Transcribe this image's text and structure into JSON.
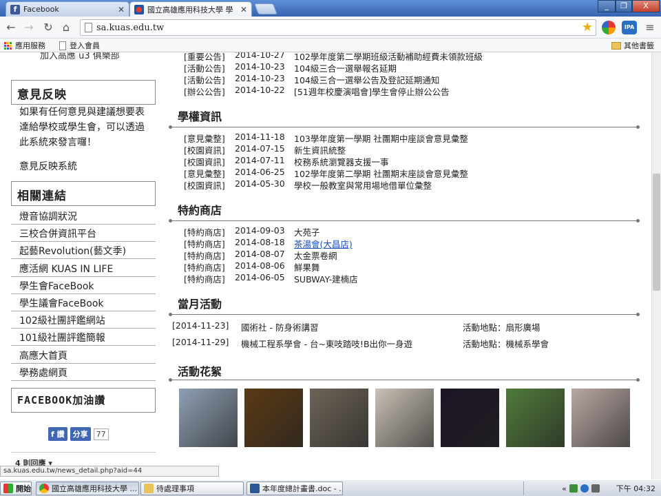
{
  "browser": {
    "tabs": [
      {
        "label": "Facebook",
        "icon": "facebook-icon"
      },
      {
        "label": "國立高雄應用科技大學 學",
        "icon": "kuas-favicon-icon"
      }
    ],
    "window_buttons": [
      "_",
      "❐",
      "X"
    ],
    "url": "sa.kuas.edu.tw",
    "bookmarks": [
      {
        "label": "應用服務",
        "icon": "apps-grid-icon"
      },
      {
        "label": "登入會員",
        "icon": "page-icon"
      }
    ],
    "other_bookmarks": "其他書籤",
    "status_url": "sa.kuas.edu.tw/news_detail.php?aid=44"
  },
  "sidebar": {
    "top_cut_text": "加入高應 u3 俱樂部",
    "feedback": {
      "title": "意見反映",
      "description": "如果有任何意見與建議想要表達給學校或學生會，可以透過此系統來發言囉！",
      "link": "意見反映系統"
    },
    "related": {
      "title": "相關連結",
      "links": [
        "燈音協調狀況",
        "三校合併資訊平台",
        "起藝Revolution(藝文季)",
        "應活網 KUAS IN LIFE",
        "學生會FaceBook",
        "學生議會FaceBook",
        "102級社團評鑑網站",
        "101級社團評鑑簡報",
        "高應大首頁",
        "學務處網頁"
      ]
    },
    "facebook": {
      "title": "FACEBOOK加油讚",
      "like_label": "讚",
      "share_label": "分享",
      "share_count": "77"
    },
    "bottom_cut_text": "4 則回應 ▾"
  },
  "announcements_top": [
    {
      "cat": "[重要公告]",
      "date": "2014-10-27",
      "title": "102學年度第二學期班級活動補助經費未領款班級"
    },
    {
      "cat": "[活動公告]",
      "date": "2014-10-23",
      "title": "104級三合一選舉報名延期"
    },
    {
      "cat": "[活動公告]",
      "date": "2014-10-23",
      "title": "104級三合一選舉公告及登記延期通知"
    },
    {
      "cat": "[辦公公告]",
      "date": "2014-10-22",
      "title": "[51週年校慶演唱會]學生會停止辦公公告"
    }
  ],
  "rights": {
    "title": "學權資訊",
    "items": [
      {
        "cat": "[意見彙整]",
        "date": "2014-11-18",
        "title": "103學年度第一學期 社團期中座談會意見彙整"
      },
      {
        "cat": "[校園資訊]",
        "date": "2014-07-15",
        "title": "新生資訊統整"
      },
      {
        "cat": "[校園資訊]",
        "date": "2014-07-11",
        "title": "校務系統瀏覽器支援一事"
      },
      {
        "cat": "[意見彙整]",
        "date": "2014-06-25",
        "title": "102學年度第二學期 社團期末座談會意見彙整"
      },
      {
        "cat": "[校園資訊]",
        "date": "2014-05-30",
        "title": "學校一般教室與常用場地借單位彙整"
      }
    ]
  },
  "stores": {
    "title": "特約商店",
    "items": [
      {
        "cat": "[特約商店]",
        "date": "2014-09-03",
        "title": "大苑子"
      },
      {
        "cat": "[特約商店]",
        "date": "2014-08-18",
        "title": "茶湯會(大昌店)"
      },
      {
        "cat": "[特約商店]",
        "date": "2014-08-07",
        "title": "太金票卷網"
      },
      {
        "cat": "[特約商店]",
        "date": "2014-08-06",
        "title": "鮮果舞"
      },
      {
        "cat": "[特約商店]",
        "date": "2014-06-05",
        "title": "SUBWAY-建楠店"
      }
    ]
  },
  "monthly": {
    "title": "當月活動",
    "items": [
      {
        "date": "[2014-11-23]",
        "name": "國術社 - 防身術講習",
        "place": "活動地點：扇形廣場"
      },
      {
        "date": "[2014-11-29]",
        "name": "機械工程系學會 - 台~東吱踏吱!B出你一身遊",
        "place": "活動地點：機械系學會"
      }
    ]
  },
  "gallery": {
    "title": "活動花絮",
    "photos": [
      "#8fa0b4",
      "#5a3a14",
      "#6d6458",
      "#c9c1b6",
      "#1c1424",
      "#4f7a3a",
      "#b9a8a4"
    ]
  },
  "taskbar": {
    "start": "開始",
    "items": [
      {
        "label": "國立高雄應用科技大學 ...",
        "icon": "chrome-icon"
      },
      {
        "label": "待處理事項",
        "icon": "folder-icon"
      },
      {
        "label": "本年度總計畫書.doc - ...",
        "icon": "word-icon"
      }
    ],
    "clock": "下午 04:32"
  }
}
